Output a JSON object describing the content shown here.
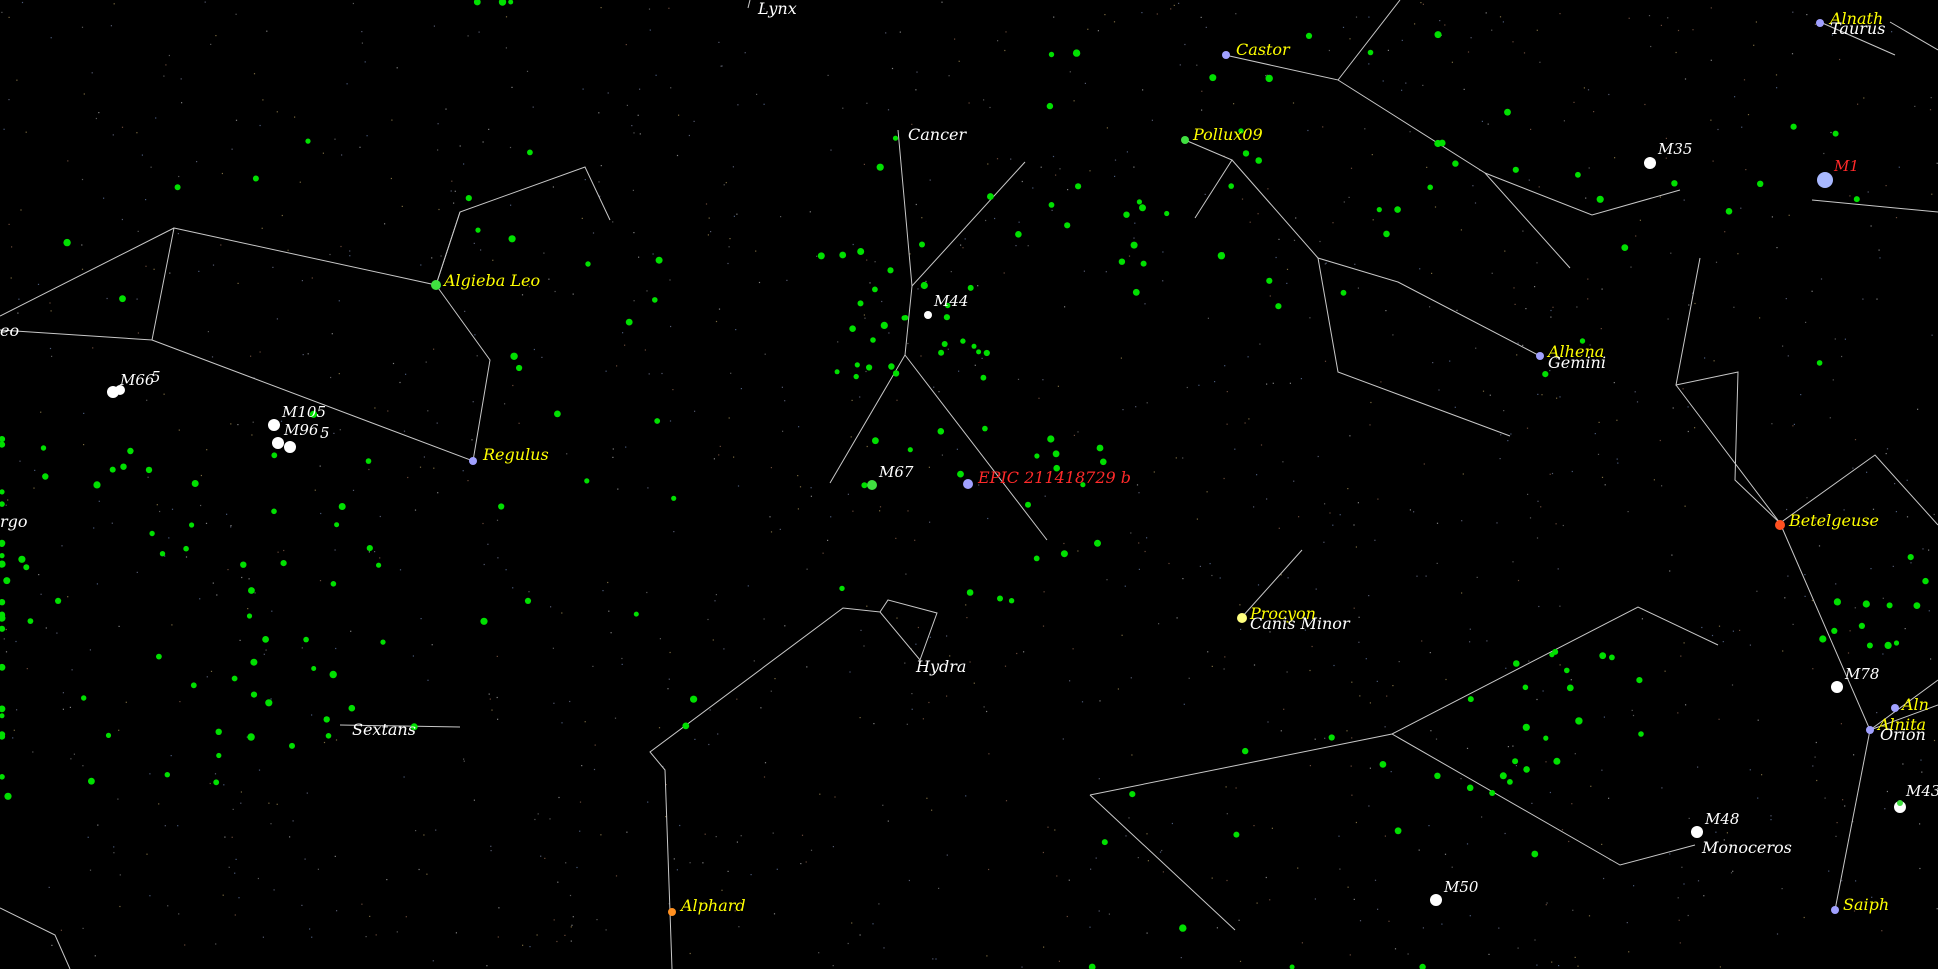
{
  "colors": {
    "background": "#000000",
    "constellation_line": "#c8c8c8",
    "star_label": "#ffff00",
    "constellation_label": "#ffffff",
    "highlight_label": "#ff2a2a",
    "galaxy_dot": "#00e000"
  },
  "stars": {
    "castor": "Castor",
    "pollux": "Pollux09",
    "alnath": "Alnath",
    "algieba": "Algieba Leo",
    "regulus": "Regulus",
    "alhena": "Alhena",
    "procyon": "Procyon",
    "betelgeuse": "Betelgeuse",
    "alphard": "Alphard",
    "alnitak": "Alnita",
    "alnilam": "Aln",
    "saiph": "Saiph"
  },
  "constellations": {
    "lynx": "Lynx",
    "cancer": "Cancer",
    "leo": "eo",
    "virgo": "rgo",
    "hydra": "Hydra",
    "sextans": "Sextans",
    "canis_minor": "Canis Minor",
    "gemini": "Gemini",
    "monoceros": "Monoceros",
    "taurus": "Taurus",
    "orion": "Orion"
  },
  "objects": {
    "m44": "M44",
    "m67": "M67",
    "m35": "M35",
    "m1": "M1",
    "m66": "M66",
    "m66b": "5",
    "m105": "M105",
    "m96": "M96",
    "m96b": "5",
    "m78": "M78",
    "m48": "M48",
    "m50": "M50",
    "m43": "M43"
  },
  "target": {
    "name": "EPIC 211418729 b"
  }
}
